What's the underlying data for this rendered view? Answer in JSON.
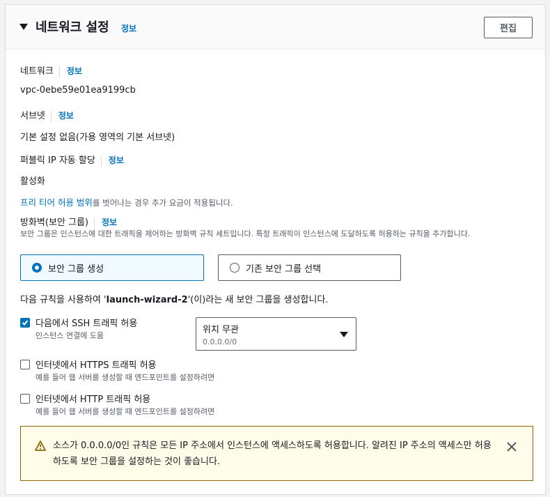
{
  "header": {
    "title": "네트워크 설정",
    "info": "정보",
    "edit_label": "편집"
  },
  "network": {
    "label": "네트워크",
    "info": "정보",
    "value": "vpc-0ebe59e01ea9199cb"
  },
  "subnet": {
    "label": "서브넷",
    "info": "정보",
    "value": "기본 설정 없음(가용 영역의 기본 서브넷)"
  },
  "public_ip": {
    "label": "퍼블릭 IP 자동 할당",
    "info": "정보",
    "value": "활성화"
  },
  "free_tier": {
    "link": "프리 티어 허용 범위",
    "text": "를 벗어나는 경우 추가 요금이 적용됩니다."
  },
  "firewall": {
    "label": "방화벽(보안 그룹)",
    "info": "정보",
    "description": "보안 그룹은 인스턴스에 대한 트래픽을 제어하는 방화벽 규칙 세트입니다. 특정 트래픽이 인스턴스에 도달하도록 허용하는 규칙을 추가합니다.",
    "options": [
      {
        "label": "보안 그룹 생성",
        "selected": true
      },
      {
        "label": "기존 보안 그룹 선택",
        "selected": false
      }
    ]
  },
  "rules_intro": {
    "prefix": "다음 규칙을 사용하여 '",
    "name": "launch-wizard-2",
    "suffix": "'(이)라는 새 보안 그룹을 생성합니다."
  },
  "rules": [
    {
      "label": "다음에서 SSH 트래픽 허용",
      "sub": "인스턴스 연결에 도움",
      "checked": true
    },
    {
      "label": "인터넷에서 HTTPS 트래픽 허용",
      "sub": "예를 들어 웹 서버를 생성할 때 엔드포인트를 설정하려면",
      "checked": false
    },
    {
      "label": "인터넷에서 HTTP 트래픽 허용",
      "sub": "예를 들어 웹 서버를 생성할 때 엔드포인트를 설정하려면",
      "checked": false
    }
  ],
  "ssh_source": {
    "value": "위치 무관",
    "sub": "0.0.0.0/0"
  },
  "warning": {
    "text": "소스가 0.0.0.0/0인 규칙은 모든 IP 주소에서 인스턴스에 액세스하도록 허용합니다. 알려진 IP 주소의 액세스만 허용하도록 보안 그룹을 설정하는 것이 좋습니다."
  },
  "colors": {
    "link": "#0073bb",
    "warning_border": "#8d6605",
    "warning_bg": "#fffce9"
  }
}
